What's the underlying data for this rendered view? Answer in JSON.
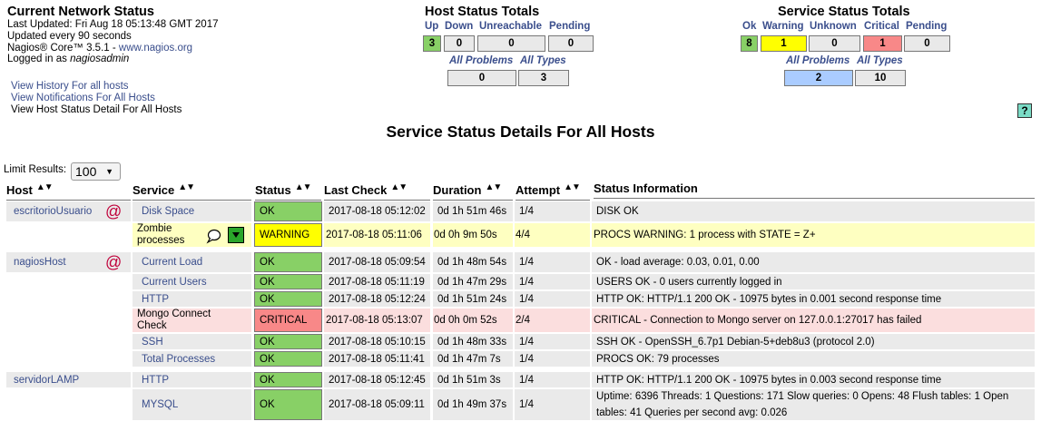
{
  "info": {
    "title": "Current Network Status",
    "last_updated": "Last Updated: Fri Aug 18 05:13:48 GMT 2017",
    "update_interval": "Updated every 90 seconds",
    "version_prefix": "Nagios® Core™ 3.5.1 - ",
    "version_link": "www.nagios.org",
    "logged_in_prefix": "Logged in as ",
    "logged_in_user": "nagiosadmin"
  },
  "links": {
    "history": "View History For all hosts",
    "notifications": "View Notifications For All Hosts",
    "host_detail": "View Host Status Detail For All Hosts"
  },
  "host_totals": {
    "title": "Host Status Totals",
    "up_label": "Up",
    "down_label": "Down",
    "unreachable_label": "Unreachable",
    "pending_label": "Pending",
    "up": "3",
    "down": "0",
    "unreachable": "0",
    "pending": "0",
    "all_problems_label": "All Problems",
    "all_types_label": "All Types",
    "all_problems": "0",
    "all_types": "3"
  },
  "service_totals": {
    "title": "Service Status Totals",
    "ok_label": "Ok",
    "warning_label": "Warning",
    "unknown_label": "Unknown",
    "critical_label": "Critical",
    "pending_label": "Pending",
    "ok": "8",
    "warning": "1",
    "unknown": "0",
    "critical": "1",
    "pending": "0",
    "all_problems_label": "All Problems",
    "all_types_label": "All Types",
    "all_problems": "2",
    "all_types": "10"
  },
  "help_icon": "?",
  "main_title": "Service Status Details For All Hosts",
  "limit": {
    "label": "Limit Results:",
    "value": "100"
  },
  "columns": {
    "host": "Host",
    "service": "Service",
    "status": "Status",
    "last_check": "Last Check",
    "duration": "Duration",
    "attempt": "Attempt",
    "info": "Status Information"
  },
  "colors": {
    "ok": "#88d066",
    "warning": "#ffff00",
    "critical": "#f88888",
    "link": "#3a4e8c"
  },
  "rows": [
    {
      "host": "escritorioUsuario",
      "service": "Disk Space",
      "status": "OK",
      "last_check": "2017-08-18 05:12:02",
      "duration": "0d 1h 51m 46s",
      "attempt": "1/4",
      "info": "DISK OK"
    },
    {
      "host": "",
      "service": "Zombie processes",
      "status": "WARNING",
      "last_check": "2017-08-18 05:11:06",
      "duration": "0d 0h 9m 50s",
      "attempt": "4/4",
      "info": "PROCS WARNING: 1 process with STATE = Z+"
    },
    {
      "host": "nagiosHost",
      "service": "Current Load",
      "status": "OK",
      "last_check": "2017-08-18 05:09:54",
      "duration": "0d 1h 48m 54s",
      "attempt": "1/4",
      "info": "OK - load average: 0.03, 0.01, 0.00"
    },
    {
      "host": "",
      "service": "Current Users",
      "status": "OK",
      "last_check": "2017-08-18 05:11:19",
      "duration": "0d 1h 47m 29s",
      "attempt": "1/4",
      "info": "USERS OK - 0 users currently logged in"
    },
    {
      "host": "",
      "service": "HTTP",
      "status": "OK",
      "last_check": "2017-08-18 05:12:24",
      "duration": "0d 1h 51m 24s",
      "attempt": "1/4",
      "info": "HTTP OK: HTTP/1.1 200 OK - 10975 bytes in 0.001 second response time"
    },
    {
      "host": "",
      "service": "Mongo Connect Check",
      "status": "CRITICAL",
      "last_check": "2017-08-18 05:13:07",
      "duration": "0d 0h 0m 52s",
      "attempt": "2/4",
      "info": "CRITICAL - Connection to Mongo server on 127.0.0.1:27017 has failed"
    },
    {
      "host": "",
      "service": "SSH",
      "status": "OK",
      "last_check": "2017-08-18 05:10:15",
      "duration": "0d 1h 48m 33s",
      "attempt": "1/4",
      "info": "SSH OK - OpenSSH_6.7p1 Debian-5+deb8u3 (protocol 2.0)"
    },
    {
      "host": "",
      "service": "Total Processes",
      "status": "OK",
      "last_check": "2017-08-18 05:11:41",
      "duration": "0d 1h 47m 7s",
      "attempt": "1/4",
      "info": "PROCS OK: 79 processes"
    },
    {
      "host": "servidorLAMP",
      "service": "HTTP",
      "status": "OK",
      "last_check": "2017-08-18 05:12:45",
      "duration": "0d 1h 51m 3s",
      "attempt": "1/4",
      "info": "HTTP OK: HTTP/1.1 200 OK - 10975 bytes in 0.003 second response time"
    },
    {
      "host": "",
      "service": "MYSQL",
      "status": "OK",
      "last_check": "2017-08-18 05:09:11",
      "duration": "0d 1h 49m 37s",
      "attempt": "1/4",
      "info": "Uptime: 6396 Threads: 1 Questions: 171 Slow queries: 0 Opens: 48 Flush tables: 1 Open tables: 41 Queries per second avg: 0.026"
    }
  ]
}
